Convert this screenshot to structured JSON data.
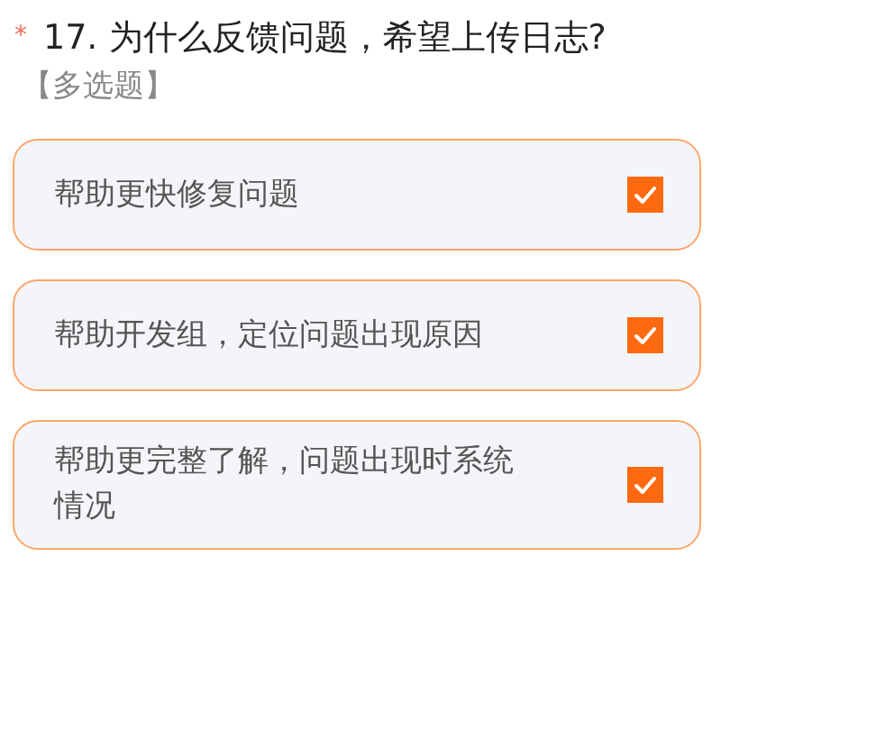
{
  "question": {
    "required_mark": "*",
    "number": "17.",
    "text": "为什么反馈问题，希望上传日志?",
    "type_label": "【多选题】"
  },
  "options": [
    {
      "label": "帮助更快修复问题",
      "checked": true
    },
    {
      "label": "帮助开发组，定位问题出现原因",
      "checked": true
    },
    {
      "label": "帮助更完整了解，问题出现时系统情况",
      "checked": true
    }
  ]
}
